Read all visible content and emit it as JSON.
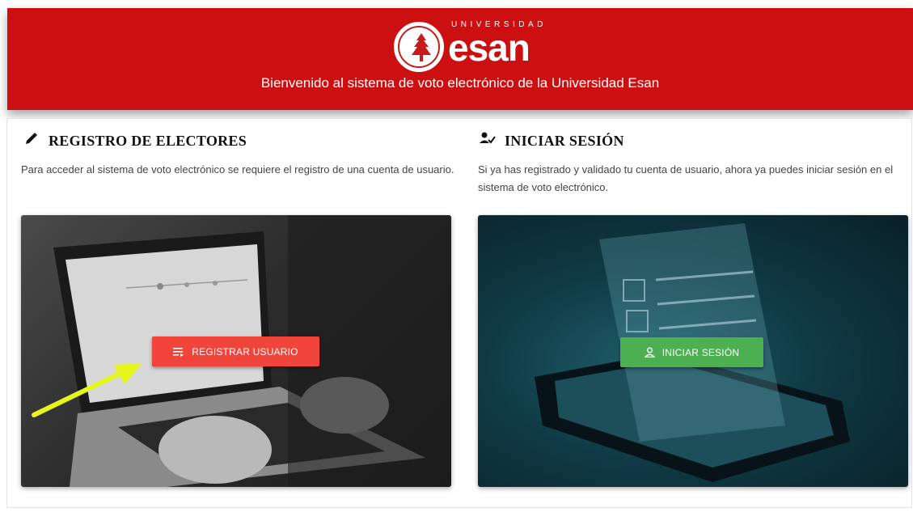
{
  "header": {
    "logo_university": "UNIVERSIDAD",
    "logo_name": "esan",
    "welcome": "Bienvenido al sistema de voto electrónico de la Universidad Esan",
    "brand_color": "#cc1011"
  },
  "register": {
    "title": "REGISTRO DE ELECTORES",
    "description": "Para acceder al sistema de voto electrónico se requiere el registro de una cuenta de usuario.",
    "button_label": "REGISTRAR USUARIO",
    "button_color": "#f1443a",
    "title_icon": "pencil-icon",
    "button_icon": "list-icon"
  },
  "login": {
    "title": "INICIAR SESIÓN",
    "description": "Si ya has registrado y validado tu cuenta de usuario, ahora ya puedes iniciar sesión en el sistema de voto electrónico.",
    "button_label": "INICIAR SESIÓN",
    "button_color": "#4caf50",
    "title_icon": "user-check-icon",
    "button_icon": "user-icon"
  },
  "annotation": {
    "arrow_color": "#e6f51c",
    "arrow_icon": "arrow-pointer-icon"
  }
}
